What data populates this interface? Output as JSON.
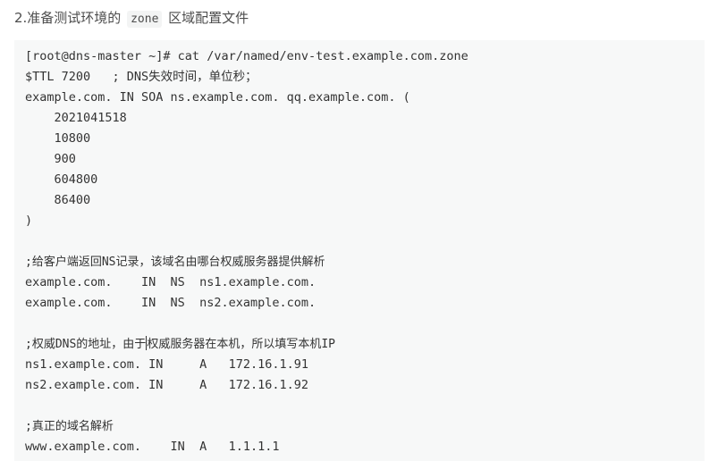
{
  "heading": {
    "prefix": "2.准备测试环境的 ",
    "code": "zone",
    "suffix": " 区域配置文件"
  },
  "code_lines": [
    "[root@dns-master ~]# cat /var/named/env-test.example.com.zone",
    "$TTL 7200   ; DNS失效时间，单位秒；",
    "example.com. IN SOA ns.example.com. qq.example.com. (",
    "    2021041518",
    "    10800",
    "    900",
    "    604800",
    "    86400",
    ")",
    "",
    ";给客户端返回NS记录，该域名由哪台权威服务器提供解析",
    "example.com.    IN  NS  ns1.example.com.",
    "example.com.    IN  NS  ns2.example.com.",
    "",
    ";权威DNS的地址，由于权威服务器在本机，所以填写本机IP",
    "ns1.example.com. IN     A   172.16.1.91",
    "ns2.example.com. IN     A   172.16.1.92",
    "",
    ";真正的域名解析",
    "www.example.com.    IN  A   1.1.1.1"
  ]
}
